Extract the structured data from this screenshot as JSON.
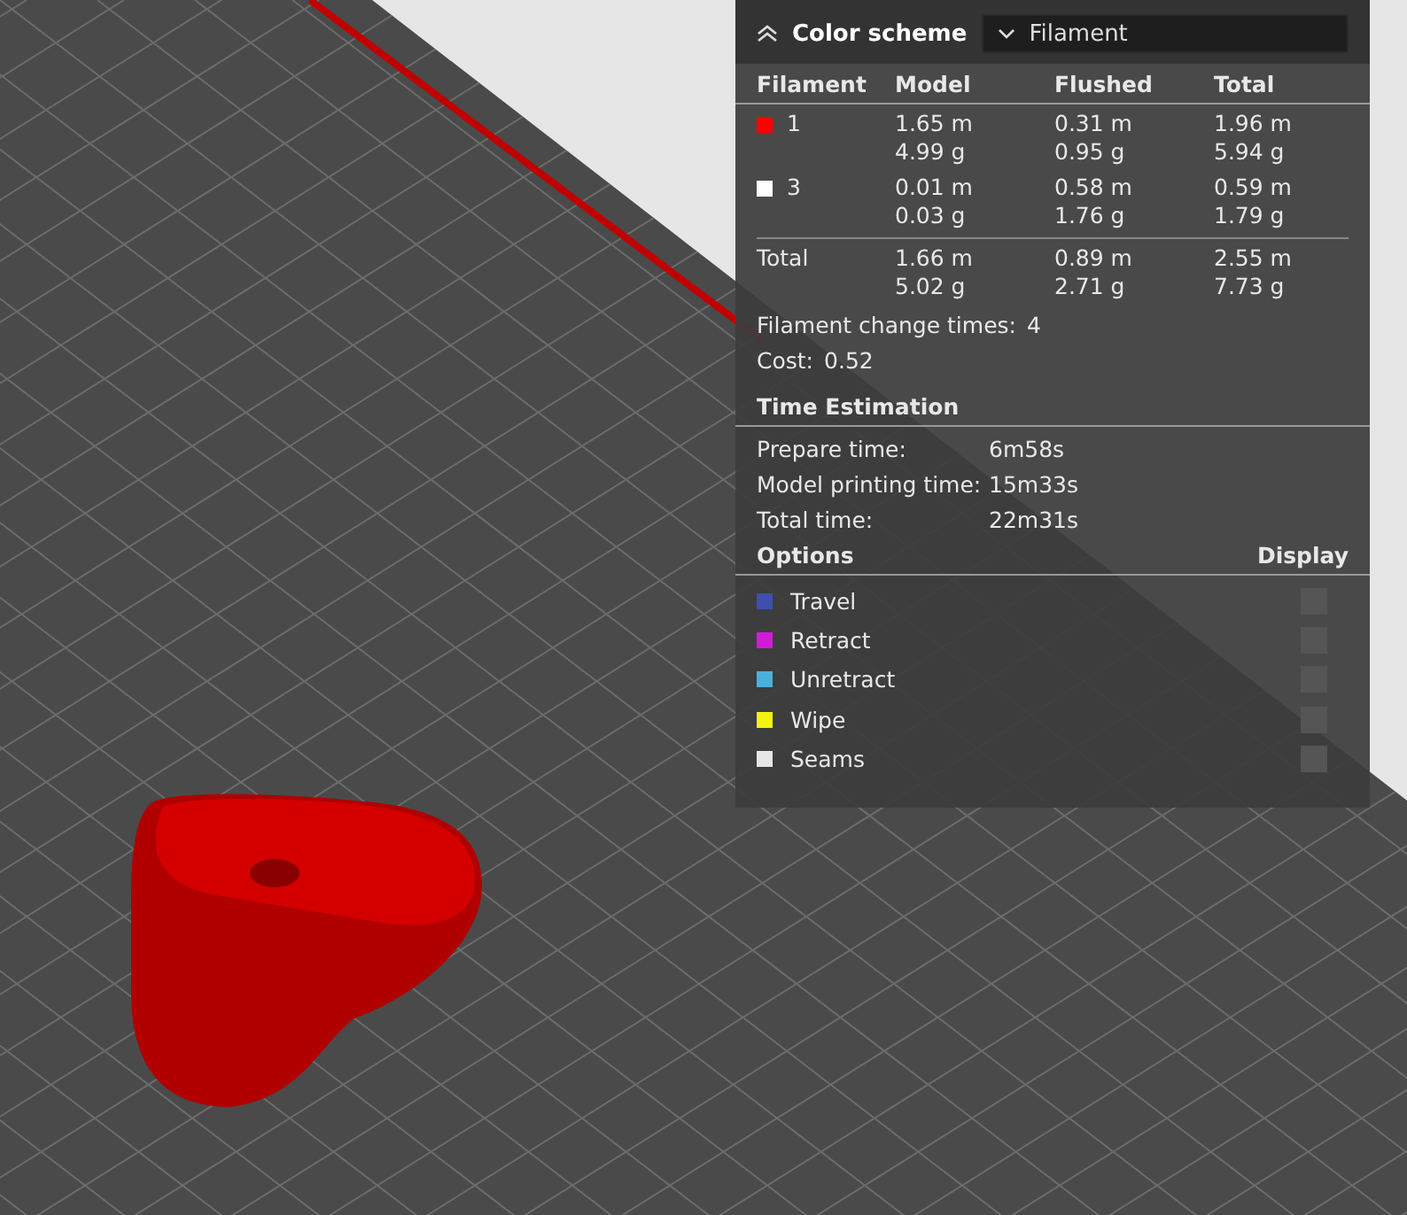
{
  "color_scheme": {
    "label": "Color scheme",
    "value": "Filament"
  },
  "filament_table": {
    "columns": [
      "Filament",
      "Model",
      "Flushed",
      "Total"
    ],
    "rows": [
      {
        "filament": "1",
        "color": "#ff0000",
        "model": [
          "1.65 m",
          "4.99 g"
        ],
        "flushed": [
          "0.31 m",
          "0.95 g"
        ],
        "total": [
          "1.96 m",
          "5.94 g"
        ]
      },
      {
        "filament": "3",
        "color": "#ffffff",
        "model": [
          "0.01 m",
          "0.03 g"
        ],
        "flushed": [
          "0.58 m",
          "1.76 g"
        ],
        "total": [
          "0.59 m",
          "1.79 g"
        ]
      }
    ],
    "total_row": {
      "label": "Total",
      "model": [
        "1.66 m",
        "5.02 g"
      ],
      "flushed": [
        "0.89 m",
        "2.71 g"
      ],
      "total": [
        "2.55 m",
        "7.73 g"
      ]
    }
  },
  "stats": [
    {
      "label": "Filament change times:",
      "value": "4"
    },
    {
      "label": "Cost:",
      "value": "0.52"
    }
  ],
  "time_estimation": {
    "title": "Time Estimation",
    "rows": [
      {
        "label": "Prepare time:",
        "value": "6m58s"
      },
      {
        "label": "Model printing time:",
        "value": "15m33s"
      },
      {
        "label": "Total time:",
        "value": "22m31s"
      }
    ]
  },
  "options": {
    "title": "Options",
    "display_label": "Display",
    "items": [
      {
        "label": "Travel",
        "color": "#3e4fb0",
        "checked": false
      },
      {
        "label": "Retract",
        "color": "#d21ad8",
        "checked": false
      },
      {
        "label": "Unretract",
        "color": "#4ab0dc",
        "checked": false
      },
      {
        "label": "Wipe",
        "color": "#f5f50a",
        "checked": false
      },
      {
        "label": "Seams",
        "color": "#e6e6e6",
        "checked": false
      }
    ]
  }
}
